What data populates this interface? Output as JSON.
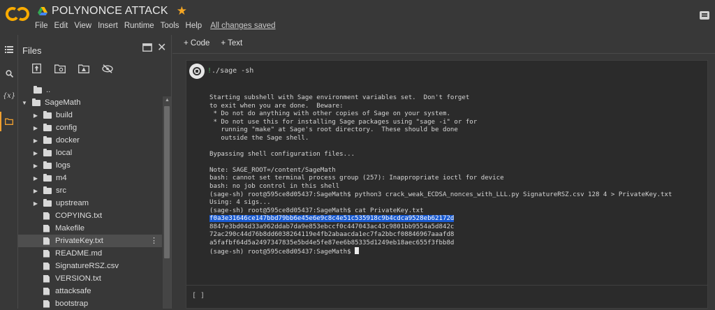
{
  "app": {
    "logo_text": "CO",
    "notebook_title": "POLYNONCE ATTACK",
    "menu": [
      "File",
      "Edit",
      "View",
      "Insert",
      "Runtime",
      "Tools",
      "Help"
    ],
    "save_status": "All changes saved"
  },
  "sidebar_rail": {
    "icons": [
      "menu-icon",
      "search-icon",
      "variables-icon",
      "folder-icon"
    ],
    "variables_label": "{x}"
  },
  "files_panel": {
    "title": "Files",
    "toolbar_icons": [
      "upload-icon",
      "refresh-folder-icon",
      "drive-icon",
      "hide-icon"
    ],
    "tree": [
      {
        "type": "parent",
        "name": ".."
      },
      {
        "type": "folder",
        "name": "SageMath",
        "expanded": true
      },
      {
        "type": "folder",
        "name": "build"
      },
      {
        "type": "folder",
        "name": "config"
      },
      {
        "type": "folder",
        "name": "docker"
      },
      {
        "type": "folder",
        "name": "local"
      },
      {
        "type": "folder",
        "name": "logs"
      },
      {
        "type": "folder",
        "name": "m4"
      },
      {
        "type": "folder",
        "name": "src"
      },
      {
        "type": "folder",
        "name": "upstream"
      },
      {
        "type": "file",
        "name": "COPYING.txt"
      },
      {
        "type": "file",
        "name": "Makefile"
      },
      {
        "type": "file",
        "name": "PrivateKey.txt",
        "selected": true
      },
      {
        "type": "file",
        "name": "README.md"
      },
      {
        "type": "file",
        "name": "SignatureRSZ.csv"
      },
      {
        "type": "file",
        "name": "VERSION.txt"
      },
      {
        "type": "file",
        "name": "attacksafe"
      },
      {
        "type": "file",
        "name": "bootstrap"
      }
    ]
  },
  "toolbar": {
    "code_label": "+ Code",
    "text_label": "+ Text"
  },
  "cell": {
    "code_prefix": "!",
    "code_rest": "./sage -sh",
    "output_lines": [
      "Starting subshell with Sage environment variables set.  Don't forget",
      "to exit when you are done.  Beware:",
      " * Do not do anything with other copies of Sage on your system.",
      " * Do not use this for installing Sage packages using \"sage -i\" or for",
      "   running \"make\" at Sage's root directory.  These should be done",
      "   outside the Sage shell.",
      "",
      "Bypassing shell configuration files...",
      "",
      "Note: SAGE_ROOT=/content/SageMath",
      "bash: cannot set terminal process group (257): Inappropriate ioctl for device",
      "bash: no job control in this shell",
      "(sage-sh) root@595ce8d05437:SageMath$ python3 crack_weak_ECDSA_nonces_with_LLL.py SignatureRSZ.csv 128 4 > PrivateKey.txt",
      "Using: 4 sigs...",
      "(sage-sh) root@595ce8d05437:SageMath$ cat PrivateKey.txt"
    ],
    "highlighted_line": "f0a3e31646ce147bbd79bb6e45e6e9c8c4e51c535918c9b4cdca9528eb62172d",
    "key_lines": [
      "8847e3bd04d33a962ddab7da9e853ebccf0c447043ac43c9801bb9554a5d842c",
      "72ac290c44d76b8dd6038264119e4fb2abaacda1ec7fa2bbcf08846967aaafd8",
      "a5fafbf64d5a2497347835e5bd4e5fe87ee6b85335d1249eb18aec655f3fbb8d"
    ],
    "prompt_line": "(sage-sh) root@595ce8d05437:SageMath$ "
  },
  "empty_cell": {
    "label": "[ ]"
  },
  "colors": {
    "accent": "#f0a030",
    "selection": "#1a5bd1",
    "background": "#383838"
  }
}
